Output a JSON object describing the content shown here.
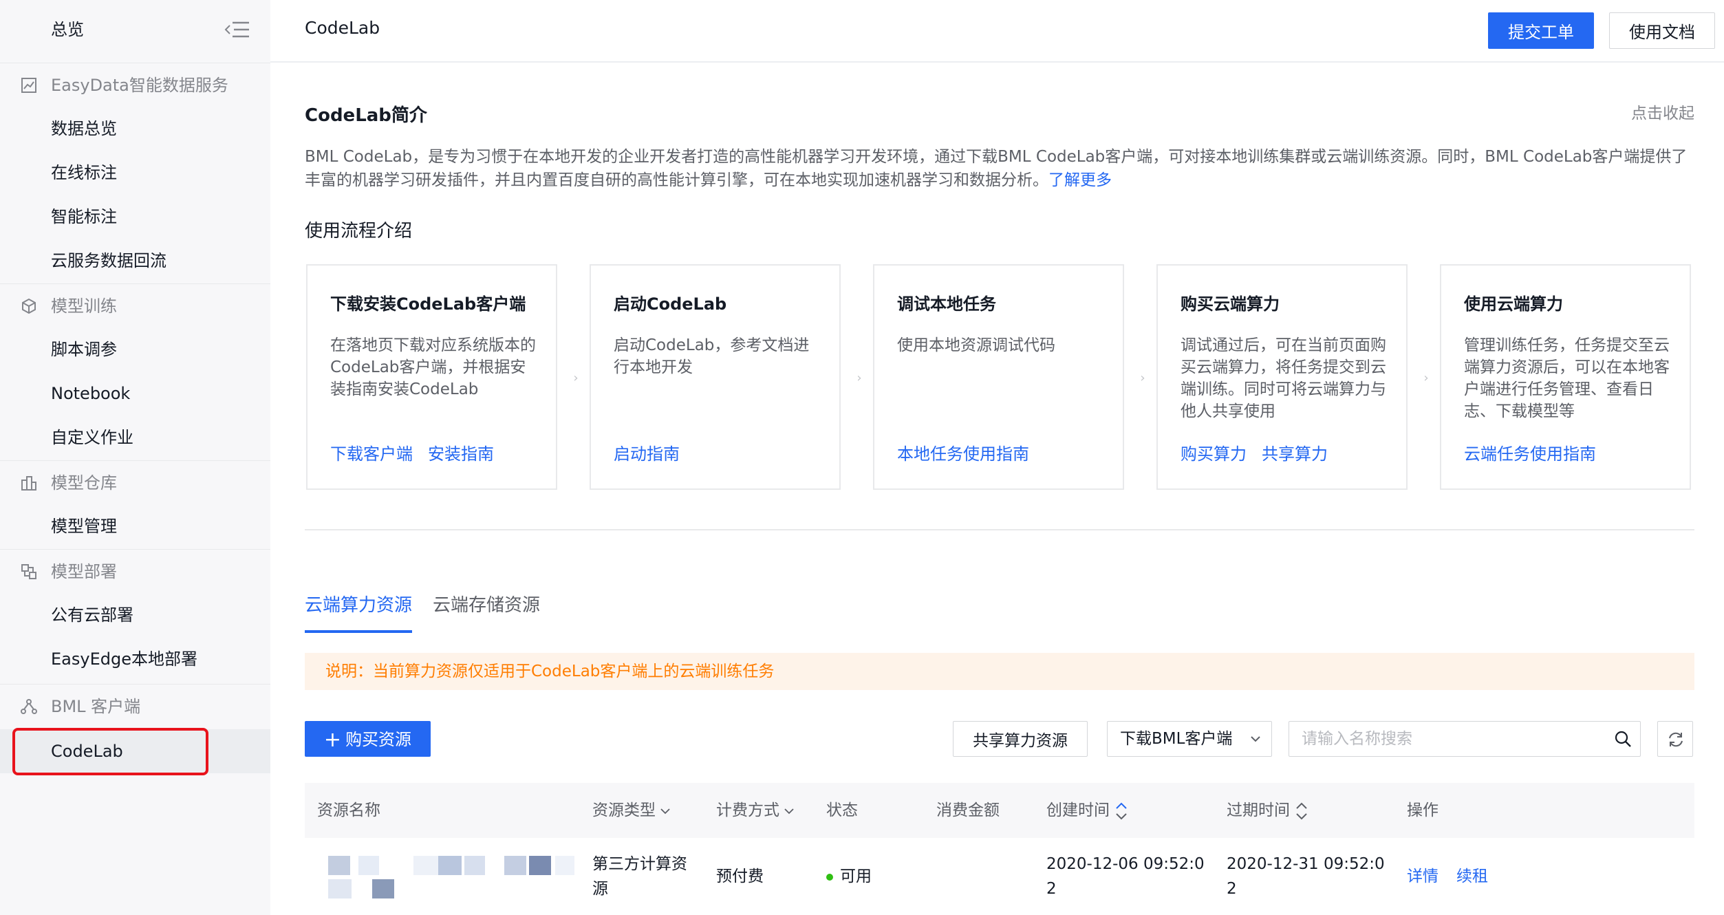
{
  "sidebar": {
    "overview": "总览",
    "groups": [
      {
        "label": "EasyData智能数据服务",
        "icon": "chart-icon",
        "items": [
          "数据总览",
          "在线标注",
          "智能标注",
          "云服务数据回流"
        ]
      },
      {
        "label": "模型训练",
        "icon": "cube-icon",
        "items": [
          "脚本调参",
          "Notebook",
          "自定义作业"
        ]
      },
      {
        "label": "模型仓库",
        "icon": "warehouse-icon",
        "items": [
          "模型管理"
        ]
      },
      {
        "label": "模型部署",
        "icon": "deploy-icon",
        "items": [
          "公有云部署",
          "EasyEdge本地部署"
        ]
      },
      {
        "label": "BML 客户端",
        "icon": "client-icon",
        "items": [
          "CodeLab"
        ]
      }
    ],
    "active_item": "CodeLab"
  },
  "header": {
    "title": "CodeLab",
    "submit_ticket": "提交工单",
    "docs": "使用文档"
  },
  "intro": {
    "title": "CodeLab简介",
    "collapse": "点击收起",
    "description": "BML CodeLab，是专为习惯于在本地开发的企业开发者打造的高性能机器学习开发环境，通过下载BML CodeLab客户端，可对接本地训练集群或云端训练资源。同时，BML CodeLab客户端提供了丰富的机器学习研发插件，并且内置百度自研的高性能计算引擎，可在本地实现加速机器学习和数据分析。",
    "learn_more": "了解更多"
  },
  "flow": {
    "title": "使用流程介绍",
    "steps": [
      {
        "title": "下载安装CodeLab客户端",
        "desc": "在落地页下载对应系统版本的CodeLab客户端，并根据安装指南安装CodeLab",
        "links": [
          "下载客户端",
          "安装指南"
        ]
      },
      {
        "title": "启动CodeLab",
        "desc": "启动CodeLab，参考文档进行本地开发",
        "links": [
          "启动指南"
        ]
      },
      {
        "title": "调试本地任务",
        "desc": "使用本地资源调试代码",
        "links": [
          "本地任务使用指南"
        ]
      },
      {
        "title": "购买云端算力",
        "desc": "调试通过后，可在当前页面购买云端算力，将任务提交到云端训练。同时可将云端算力与他人共享使用",
        "links": [
          "购买算力",
          "共享算力"
        ]
      },
      {
        "title": "使用云端算力",
        "desc": "管理训练任务，任务提交至云端算力资源后，可以在本地客户端进行任务管理、查看日志、下载模型等",
        "links": [
          "云端任务使用指南"
        ]
      }
    ]
  },
  "tabs": [
    "云端算力资源",
    "云端存储资源"
  ],
  "notice": "说明：当前算力资源仅适用于CodeLab客户端上的云端训练任务",
  "toolbar": {
    "buy": "购买资源",
    "share": "共享算力资源",
    "download": "下载BML客户端",
    "search_placeholder": "请输入名称搜索"
  },
  "table": {
    "columns": [
      "资源名称",
      "资源类型",
      "计费方式",
      "状态",
      "消费金额",
      "创建时间",
      "过期时间",
      "操作"
    ],
    "rows": [
      {
        "type_line1": "第三方计算资",
        "type_line2": "源",
        "billing": "预付费",
        "status": "可用",
        "created_line1": "2020-12-06 09:52:0",
        "created_line2": "2",
        "expires_line1": "2020-12-31 09:52:0",
        "expires_line2": "2",
        "actions": [
          "详情",
          "续租"
        ]
      }
    ]
  },
  "colors": {
    "primary": "#2468f2",
    "notice_bg": "#fef3e9",
    "notice_text": "#ff7d00",
    "highlight": "#e8131c",
    "status_ok": "#30bf13"
  }
}
